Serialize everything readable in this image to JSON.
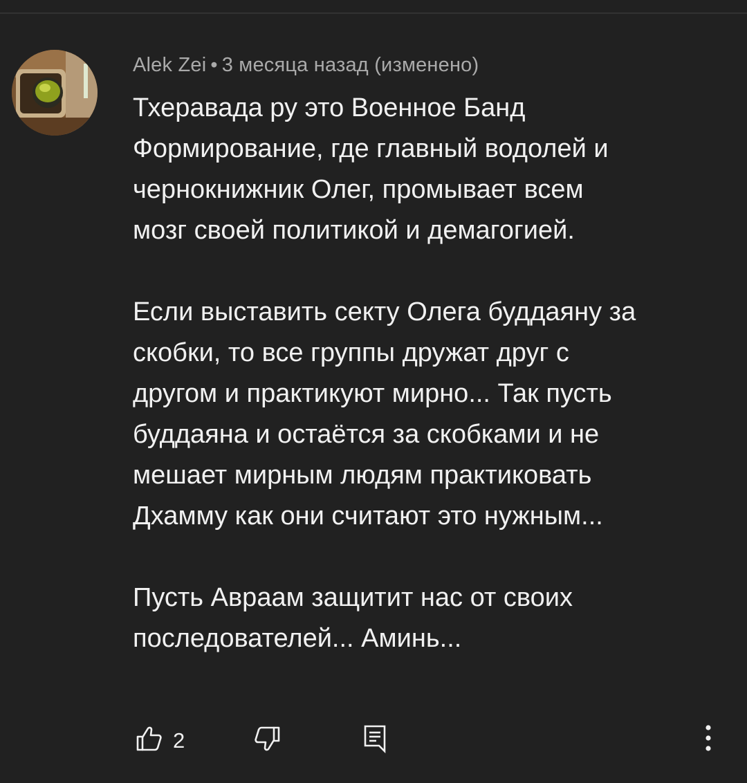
{
  "comment": {
    "author": "Alek Zei",
    "separator": "•",
    "time": "3 месяца назад",
    "edited": "(изменено)",
    "lines": [
      "Тхеравада ру это Военное Банд",
      "Формирование, где главный водолей и",
      "чернокнижник Олег, промывает всем",
      "мозг своей политикой и демагогией.",
      "",
      "Если выставить секту Олега буддаяну за",
      "скобки, то все группы дружат друг с",
      "другом и практикуют мирно... Так пусть",
      "буддаяна и остаётся за скобками и не",
      "мешает мирным людям практиковать",
      "Дхамму как они считают это нужным...",
      "",
      "Пусть Авраам защитит нас от своих",
      "последователей... Аминь..."
    ]
  },
  "actions": {
    "like_count": "2",
    "like_icon": "thumb-up-outline-icon",
    "dislike_icon": "thumb-down-outline-icon",
    "reply_icon": "reply-comment-icon",
    "more_icon": "more-vertical-icon"
  },
  "colors": {
    "background": "#212121",
    "text": "#f1f1f1",
    "meta_text": "#aaaaaa",
    "divider": "#323232"
  }
}
